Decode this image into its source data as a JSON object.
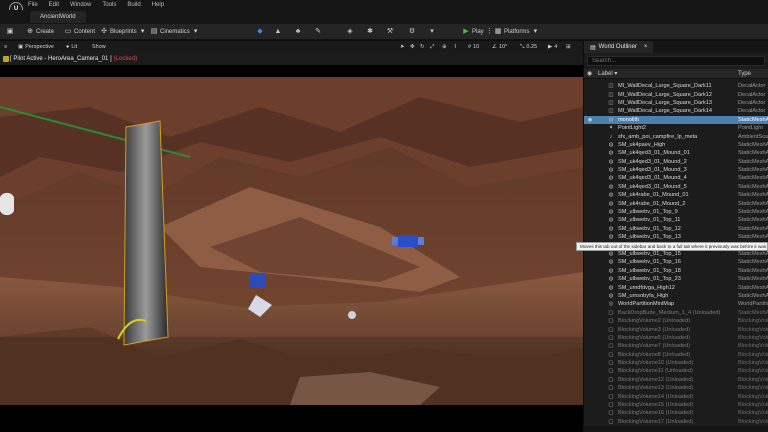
{
  "menu": {
    "items": [
      "File",
      "Edit",
      "Window",
      "Tools",
      "Build",
      "Help"
    ]
  },
  "level_tab": {
    "label": "AncientWorld"
  },
  "toolbar": {
    "save_icon": "save-icon",
    "create_label": "Create",
    "content_label": "Content",
    "blueprints_label": "Blueprints",
    "cinematics_label": "Cinematics",
    "play_label": "Play",
    "platforms_label": "Platforms"
  },
  "viewport": {
    "perspective_label": "Perspective",
    "lit_label": "Lit",
    "show_label": "Show",
    "grid_snap": "10",
    "rot_snap": "10°",
    "scale_snap": "0.25",
    "camera_speed": "4",
    "pilot_text": "[ Pilot Active - HeroArea_Camera_01 ]",
    "pilot_locked": "(Locked)"
  },
  "outliner": {
    "tab_label": "World Outliner",
    "search_placeholder": "Search...",
    "col_label": "Label",
    "col_type": "Type",
    "rows": [
      {
        "label": "MI_WallDecal_Large_Square_Dark11",
        "type": "DecalActor",
        "icon": "decal-icon",
        "state": "normal"
      },
      {
        "label": "MI_WallDecal_Large_Square_Dark12",
        "type": "DecalActor",
        "icon": "decal-icon",
        "state": "normal"
      },
      {
        "label": "MI_WallDecal_Large_Square_Dark13",
        "type": "DecalActor",
        "icon": "decal-icon",
        "state": "normal"
      },
      {
        "label": "MI_WallDecal_Large_Square_Dark14",
        "type": "DecalActor",
        "icon": "decal-icon",
        "state": "normal"
      },
      {
        "label": "monolith",
        "type": "StaticMeshA",
        "icon": "mesh-icon",
        "state": "selected"
      },
      {
        "label": "PointLight2",
        "type": "PointLight",
        "icon": "light-icon",
        "state": "normal"
      },
      {
        "label": "sfx_amb_poi_campfire_lp_meta",
        "type": "AmbientSou",
        "icon": "sound-icon",
        "state": "normal"
      },
      {
        "label": "SM_uk4paev_High",
        "type": "StaticMeshA",
        "icon": "mesh-icon",
        "state": "normal"
      },
      {
        "label": "SM_uk4qed3_01_Mound_01",
        "type": "StaticMeshA",
        "icon": "mesh-icon",
        "state": "normal"
      },
      {
        "label": "SM_uk4qed3_01_Mound_2",
        "type": "StaticMeshA",
        "icon": "mesh-icon",
        "state": "normal"
      },
      {
        "label": "SM_uk4qed3_01_Mound_3",
        "type": "StaticMeshA",
        "icon": "mesh-icon",
        "state": "normal"
      },
      {
        "label": "SM_uk4qed3_01_Mound_4",
        "type": "StaticMeshA",
        "icon": "mesh-icon",
        "state": "normal"
      },
      {
        "label": "SM_uk4qed3_01_Mound_5",
        "type": "StaticMeshA",
        "icon": "mesh-icon",
        "state": "normal"
      },
      {
        "label": "SM_uk4rabe_01_Mound_01",
        "type": "StaticMeshA",
        "icon": "mesh-icon",
        "state": "normal"
      },
      {
        "label": "SM_uk4rabe_01_Mound_2",
        "type": "StaticMeshA",
        "icon": "mesh-icon",
        "state": "normal"
      },
      {
        "label": "SM_ulbwebv_01_Top_9",
        "type": "StaticMeshA",
        "icon": "mesh-icon",
        "state": "normal"
      },
      {
        "label": "SM_ulbwebv_01_Top_11",
        "type": "StaticMeshA",
        "icon": "mesh-icon",
        "state": "normal"
      },
      {
        "label": "SM_ulbwebv_01_Top_12",
        "type": "StaticMeshA",
        "icon": "mesh-icon",
        "state": "normal"
      },
      {
        "label": "SM_ulbwebv_01_Top_13",
        "type": "StaticMeshA",
        "icon": "mesh-icon",
        "state": "normal"
      },
      {
        "label": "SM_ulbwebv_01_Top_14",
        "type": "StaticMeshA",
        "icon": "mesh-icon",
        "state": "normal"
      },
      {
        "label": "SM_ulbwebv_01_Top_15",
        "type": "StaticMeshA",
        "icon": "mesh-icon",
        "state": "normal"
      },
      {
        "label": "SM_ulbwebv_01_Top_16",
        "type": "StaticMeshA",
        "icon": "mesh-icon",
        "state": "normal"
      },
      {
        "label": "SM_ulbwebv_01_Top_18",
        "type": "StaticMeshA",
        "icon": "mesh-icon",
        "state": "normal"
      },
      {
        "label": "SM_ulbwebv_01_Top_23",
        "type": "StaticMeshA",
        "icon": "mesh-icon",
        "state": "normal"
      },
      {
        "label": "SM_umdfdvga_High12",
        "type": "StaticMeshA",
        "icon": "mesh-icon",
        "state": "normal"
      },
      {
        "label": "SM_umsobyfa_High",
        "type": "StaticMeshA",
        "icon": "mesh-icon",
        "state": "normal"
      },
      {
        "label": "WorldPartitionMiniMap",
        "type": "WorldPartitio",
        "icon": "map-icon",
        "state": "normal"
      },
      {
        "label": "BackDropButte_Medium_1_4 (Unloaded)",
        "type": "StaticMeshA",
        "icon": "unloaded-icon",
        "state": "unloaded"
      },
      {
        "label": "BlockingVolume2 (Unloaded)",
        "type": "BlockingVolu",
        "icon": "unloaded-icon",
        "state": "unloaded"
      },
      {
        "label": "BlockingVolume3 (Unloaded)",
        "type": "BlockingVolu",
        "icon": "unloaded-icon",
        "state": "unloaded"
      },
      {
        "label": "BlockingVolume5 (Unloaded)",
        "type": "BlockingVolu",
        "icon": "unloaded-icon",
        "state": "unloaded"
      },
      {
        "label": "BlockingVolume7 (Unloaded)",
        "type": "BlockingVolu",
        "icon": "unloaded-icon",
        "state": "unloaded"
      },
      {
        "label": "BlockingVolume8 (Unloaded)",
        "type": "BlockingVolu",
        "icon": "unloaded-icon",
        "state": "unloaded"
      },
      {
        "label": "BlockingVolume10 (Unloaded)",
        "type": "BlockingVolu",
        "icon": "unloaded-icon",
        "state": "unloaded"
      },
      {
        "label": "BlockingVolume11 (Unloaded)",
        "type": "BlockingVolu",
        "icon": "unloaded-icon",
        "state": "unloaded"
      },
      {
        "label": "BlockingVolume12 (Unloaded)",
        "type": "BlockingVolu",
        "icon": "unloaded-icon",
        "state": "unloaded"
      },
      {
        "label": "BlockingVolume13 (Unloaded)",
        "type": "BlockingVolu",
        "icon": "unloaded-icon",
        "state": "unloaded"
      },
      {
        "label": "BlockingVolume14 (Unloaded)",
        "type": "BlockingVolu",
        "icon": "unloaded-icon",
        "state": "unloaded"
      },
      {
        "label": "BlockingVolume15 (Unloaded)",
        "type": "BlockingVolu",
        "icon": "unloaded-icon",
        "state": "unloaded"
      },
      {
        "label": "BlockingVolume16 (Unloaded)",
        "type": "BlockingVolu",
        "icon": "unloaded-icon",
        "state": "unloaded"
      },
      {
        "label": "BlockingVolume17 (Unloaded)",
        "type": "BlockingVolu",
        "icon": "unloaded-icon",
        "state": "unloaded"
      }
    ]
  },
  "tooltip": {
    "text": "Moves this tab out of the sidebar and back to a full tab where it previously was before it was added to the sidebar."
  },
  "colors": {
    "selected_row": "#4a7fae",
    "play_green": "#3ec43e",
    "locked_red": "#e24545",
    "pilot_badge": "#c4a41c"
  }
}
